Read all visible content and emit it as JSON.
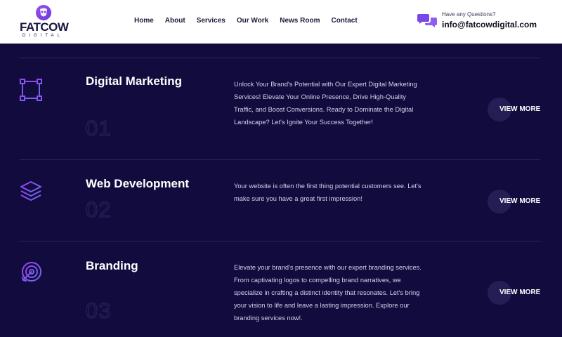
{
  "header": {
    "logo": {
      "name": "FATCOW",
      "sub": "DIGITAL"
    },
    "nav": [
      "Home",
      "About",
      "Services",
      "Our Work",
      "News Room",
      "Contact"
    ],
    "contact": {
      "question": "Have any Questions?",
      "email": "info@fatcowdigital.com"
    }
  },
  "services": [
    {
      "icon": "selection-square-icon",
      "title": "Digital Marketing",
      "number": "01",
      "description": "Unlock Your Brand's Potential with Our Expert Digital Marketing Services! Elevate Your Online Presence, Drive High-Quality Traffic, and Boost Conversions. Ready to Dominate the Digital Landscape? Let's Ignite Your Success Together!",
      "button": "VIEW MORE"
    },
    {
      "icon": "layers-icon",
      "title": "Web Development",
      "number": "02",
      "description": "Your website is often the first thing potential customers see. Let's make sure you have a great first impression!",
      "button": "VIEW MORE"
    },
    {
      "icon": "target-icon",
      "title": "Branding",
      "number": "03",
      "description": "Elevate your brand's presence with our expert branding services. From captivating logos to compelling brand narratives, we specialize in crafting a distinct identity that resonates. Let's bring your vision to life and leave a lasting impression. Explore our branding services now!.",
      "button": "VIEW MORE"
    }
  ],
  "colors": {
    "background": "#120c3e",
    "accent": "#8b3fe0",
    "icon_gradient_end": "#6a6cf0"
  }
}
